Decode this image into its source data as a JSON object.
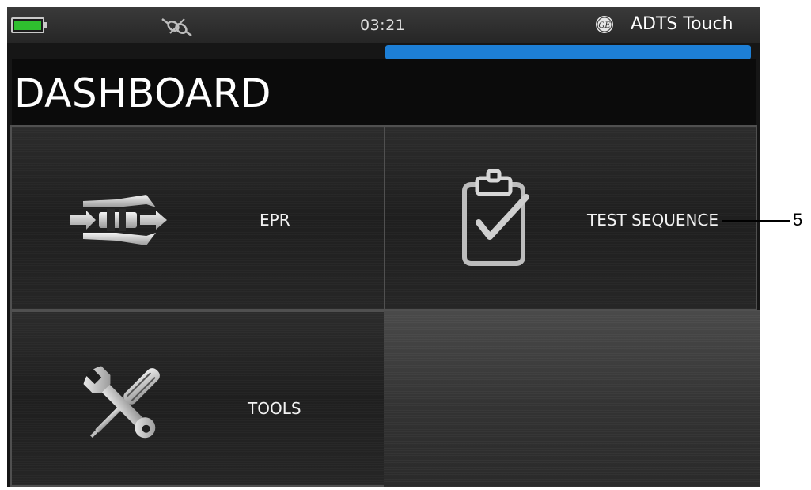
{
  "status_bar": {
    "battery_icon": "battery-full-icon",
    "battery_level": 1.0,
    "battery_color": "#2fbf2f",
    "connection_icon": "unplugged-connector-icon",
    "time": "03:21",
    "brand_icon": "ge-logo-icon",
    "device_name": "ADTS Touch"
  },
  "progress": {
    "value": 1.0,
    "color": "#1d7fd6"
  },
  "header": {
    "title": "DASHBOARD"
  },
  "tiles": [
    {
      "label": "EPR",
      "icon": "epr-icon"
    },
    {
      "label": "TEST SEQUENCE",
      "icon": "clipboard-check-icon"
    },
    {
      "label": "TOOLS",
      "icon": "wrench-screwdriver-icon"
    }
  ],
  "annotation": {
    "callout_number": "5"
  }
}
